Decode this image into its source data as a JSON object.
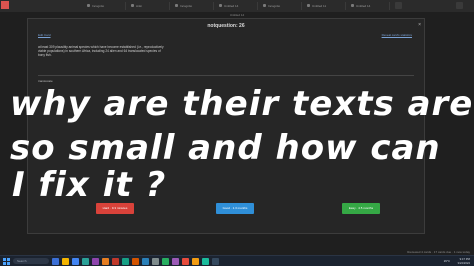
{
  "tabs": [
    {
      "label": "Incognito"
    },
    {
      "label": "Anki"
    },
    {
      "label": "Incognito"
    },
    {
      "label": "Untitled 14"
    },
    {
      "label": "Incognito"
    },
    {
      "label": "Untitled 11"
    },
    {
      "label": "Untitled 14"
    }
  ],
  "window_title": "Untitled 14",
  "modal": {
    "title": "notquestion: 26",
    "close_icon": "×",
    "link_left": "Edit Card",
    "link_right": "Reveal card's statistics",
    "body_text": "at least 309 plausibly animal species which have become established (i.e., reproductively viable populations) in southern Africa, including 24 alien and 64 translocated species of bony fish.",
    "guess_label": "translocate"
  },
  "buttons": {
    "hard": "Hard · 9.3 minutes",
    "good": "Good · 1.3 months",
    "easy": "Easy · 4.5 months"
  },
  "annotation": {
    "line1": "why are their texts are",
    "line2": "so small and how can",
    "line3": "I fix it ?"
  },
  "status_bar": "Reviewed 4 cards · 17 cards due · 1 new today",
  "taskbar": {
    "search_placeholder": "Search",
    "weather": "29°C",
    "time": "9:47 PM",
    "date": "3/24/2024"
  },
  "colors": {
    "hard": "#d9423a",
    "good": "#2f8fd8",
    "easy": "#35a845",
    "link": "#7aa2d6"
  }
}
